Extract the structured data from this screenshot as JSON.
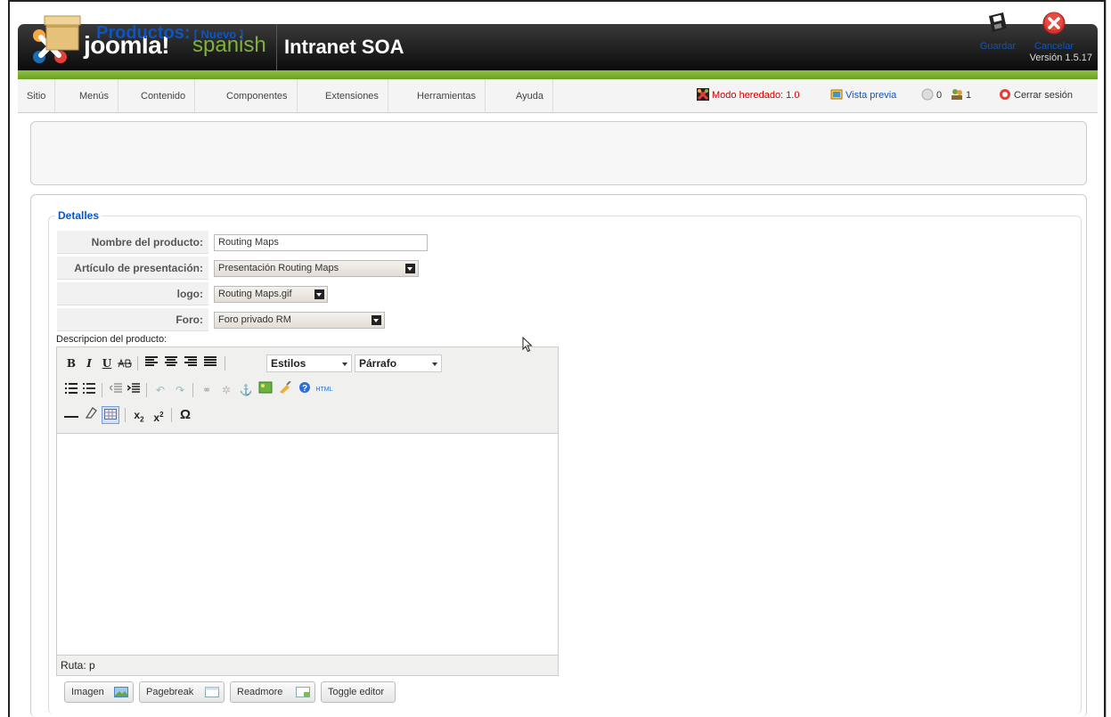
{
  "header": {
    "logo_text": "joomla!",
    "logo_suffix": "spanish",
    "site_name": "Intranet SOA",
    "version": "Versión 1.5.17"
  },
  "menu": {
    "items": [
      "Sitio",
      "Menús",
      "Contenido",
      "Componentes",
      "Extensiones",
      "Herramientas",
      "Ayuda"
    ]
  },
  "status": {
    "legacy_mode": "Modo heredado: 1.0",
    "preview": "Vista previa",
    "messages_count": "0",
    "users_count": "1",
    "logout": "Cerrar sesión"
  },
  "toolbar": {
    "title": "Productos:",
    "subtitle": "[ Nuevo ]",
    "save_label": "Guardar",
    "cancel_label": "Cancelar"
  },
  "form": {
    "legend": "Detalles",
    "product_name_label": "Nombre del producto:",
    "product_name_value": "Routing Maps",
    "presentation_label": "Artículo de presentación:",
    "presentation_value": "Presentación Routing Maps",
    "logo_label": "logo:",
    "logo_value": "Routing Maps.gif",
    "forum_label": "Foro:",
    "forum_value": "Foro privado RM",
    "description_label": "Descripcion del producto:"
  },
  "editor": {
    "styles_select": "Estilos",
    "format_select": "Párrafo",
    "path_text": "Ruta: p",
    "html_button": "HTML"
  },
  "editor_buttons": {
    "image": "Imagen",
    "pagebreak": "Pagebreak",
    "readmore": "Readmore",
    "toggle": "Toggle editor"
  },
  "colors": {
    "accent_blue": "#0b55c4",
    "header_green": "#7fb23a"
  }
}
